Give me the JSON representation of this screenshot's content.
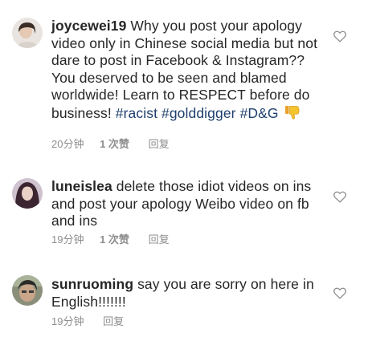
{
  "comments": [
    {
      "username": "joycewei19",
      "text_part1": " Why you post your apology video only in Chinese social media but not dare to post in Facebook & Instagram?? You deserved to be seen and blamed worldwide! Learn to RESPECT before do business! ",
      "hashtags": [
        "#racist",
        "#golddigger",
        "#D&G"
      ],
      "emoji": "thumbs-down-icon",
      "time": "20分钟",
      "likes": "1 次赞",
      "reply": "回复"
    },
    {
      "username": "luneislea",
      "text_part1": " delete those idiot videos on ins and post your apology Weibo video on fb and ins",
      "time": "19分钟",
      "likes": "1 次赞",
      "reply": "回复"
    },
    {
      "username": "sunruoming",
      "text_part1": " say you are sorry on here in English!!!!!!!",
      "time": "19分钟",
      "reply": "回复"
    }
  ],
  "colors": {
    "text": "#262626",
    "meta": "#8e8e8e",
    "hashtag": "#1f3f6e",
    "heart_stroke": "#8e8e8e"
  }
}
